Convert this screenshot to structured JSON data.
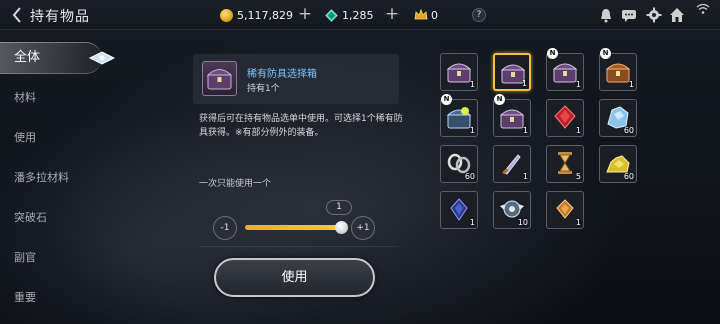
{
  "window": {
    "title": "持有物品"
  },
  "resources": {
    "gold": "5,117,829",
    "gems": "1,285",
    "crowns": "0",
    "help": "?"
  },
  "sidebar": {
    "items": [
      {
        "label": "全体",
        "active": true
      },
      {
        "label": "材料"
      },
      {
        "label": "使用"
      },
      {
        "label": "潘多拉材料"
      },
      {
        "label": "突破石"
      },
      {
        "label": "副官"
      },
      {
        "label": "重要"
      }
    ]
  },
  "detail": {
    "name": "稀有防具选择箱",
    "own": "持有1个",
    "description": "获得后可在持有物品选单中使用。可选择1个稀有防具获得。※有部分例外的装备。",
    "use_once": "一次只能使用一个",
    "minus_label": "-1",
    "plus_label": "+1",
    "slider_value": "1",
    "use_button": "使用"
  },
  "inventory": [
    {
      "count": "1",
      "icon": "chest-purple-icon",
      "badge": ""
    },
    {
      "count": "1",
      "icon": "chest-purple-icon",
      "badge": "",
      "selected": true
    },
    {
      "count": "1",
      "icon": "chest-purple-icon",
      "badge": "N"
    },
    {
      "count": "1",
      "icon": "chest-orange-icon",
      "badge": "N"
    },
    {
      "count": "1",
      "icon": "chest-blue-icon",
      "badge": "N"
    },
    {
      "count": "1",
      "icon": "chest-purple-icon",
      "badge": "N"
    },
    {
      "count": "1",
      "icon": "red-crystal-icon",
      "badge": ""
    },
    {
      "count": "60",
      "icon": "blue-ore-icon",
      "badge": ""
    },
    {
      "count": "60",
      "icon": "silver-chain-icon",
      "badge": ""
    },
    {
      "count": "1",
      "icon": "dagger-icon",
      "badge": ""
    },
    {
      "count": "5",
      "icon": "hourglass-icon",
      "badge": ""
    },
    {
      "count": "60",
      "icon": "gold-ore-icon",
      "badge": ""
    },
    {
      "count": "1",
      "icon": "blue-gem-icon",
      "badge": ""
    },
    {
      "count": "10",
      "icon": "winged-emblem-icon",
      "badge": ""
    },
    {
      "count": "1",
      "icon": "amber-gem-icon",
      "badge": ""
    }
  ],
  "colors": {
    "accent": "#f0c040",
    "item_name": "#7fc4ff"
  }
}
